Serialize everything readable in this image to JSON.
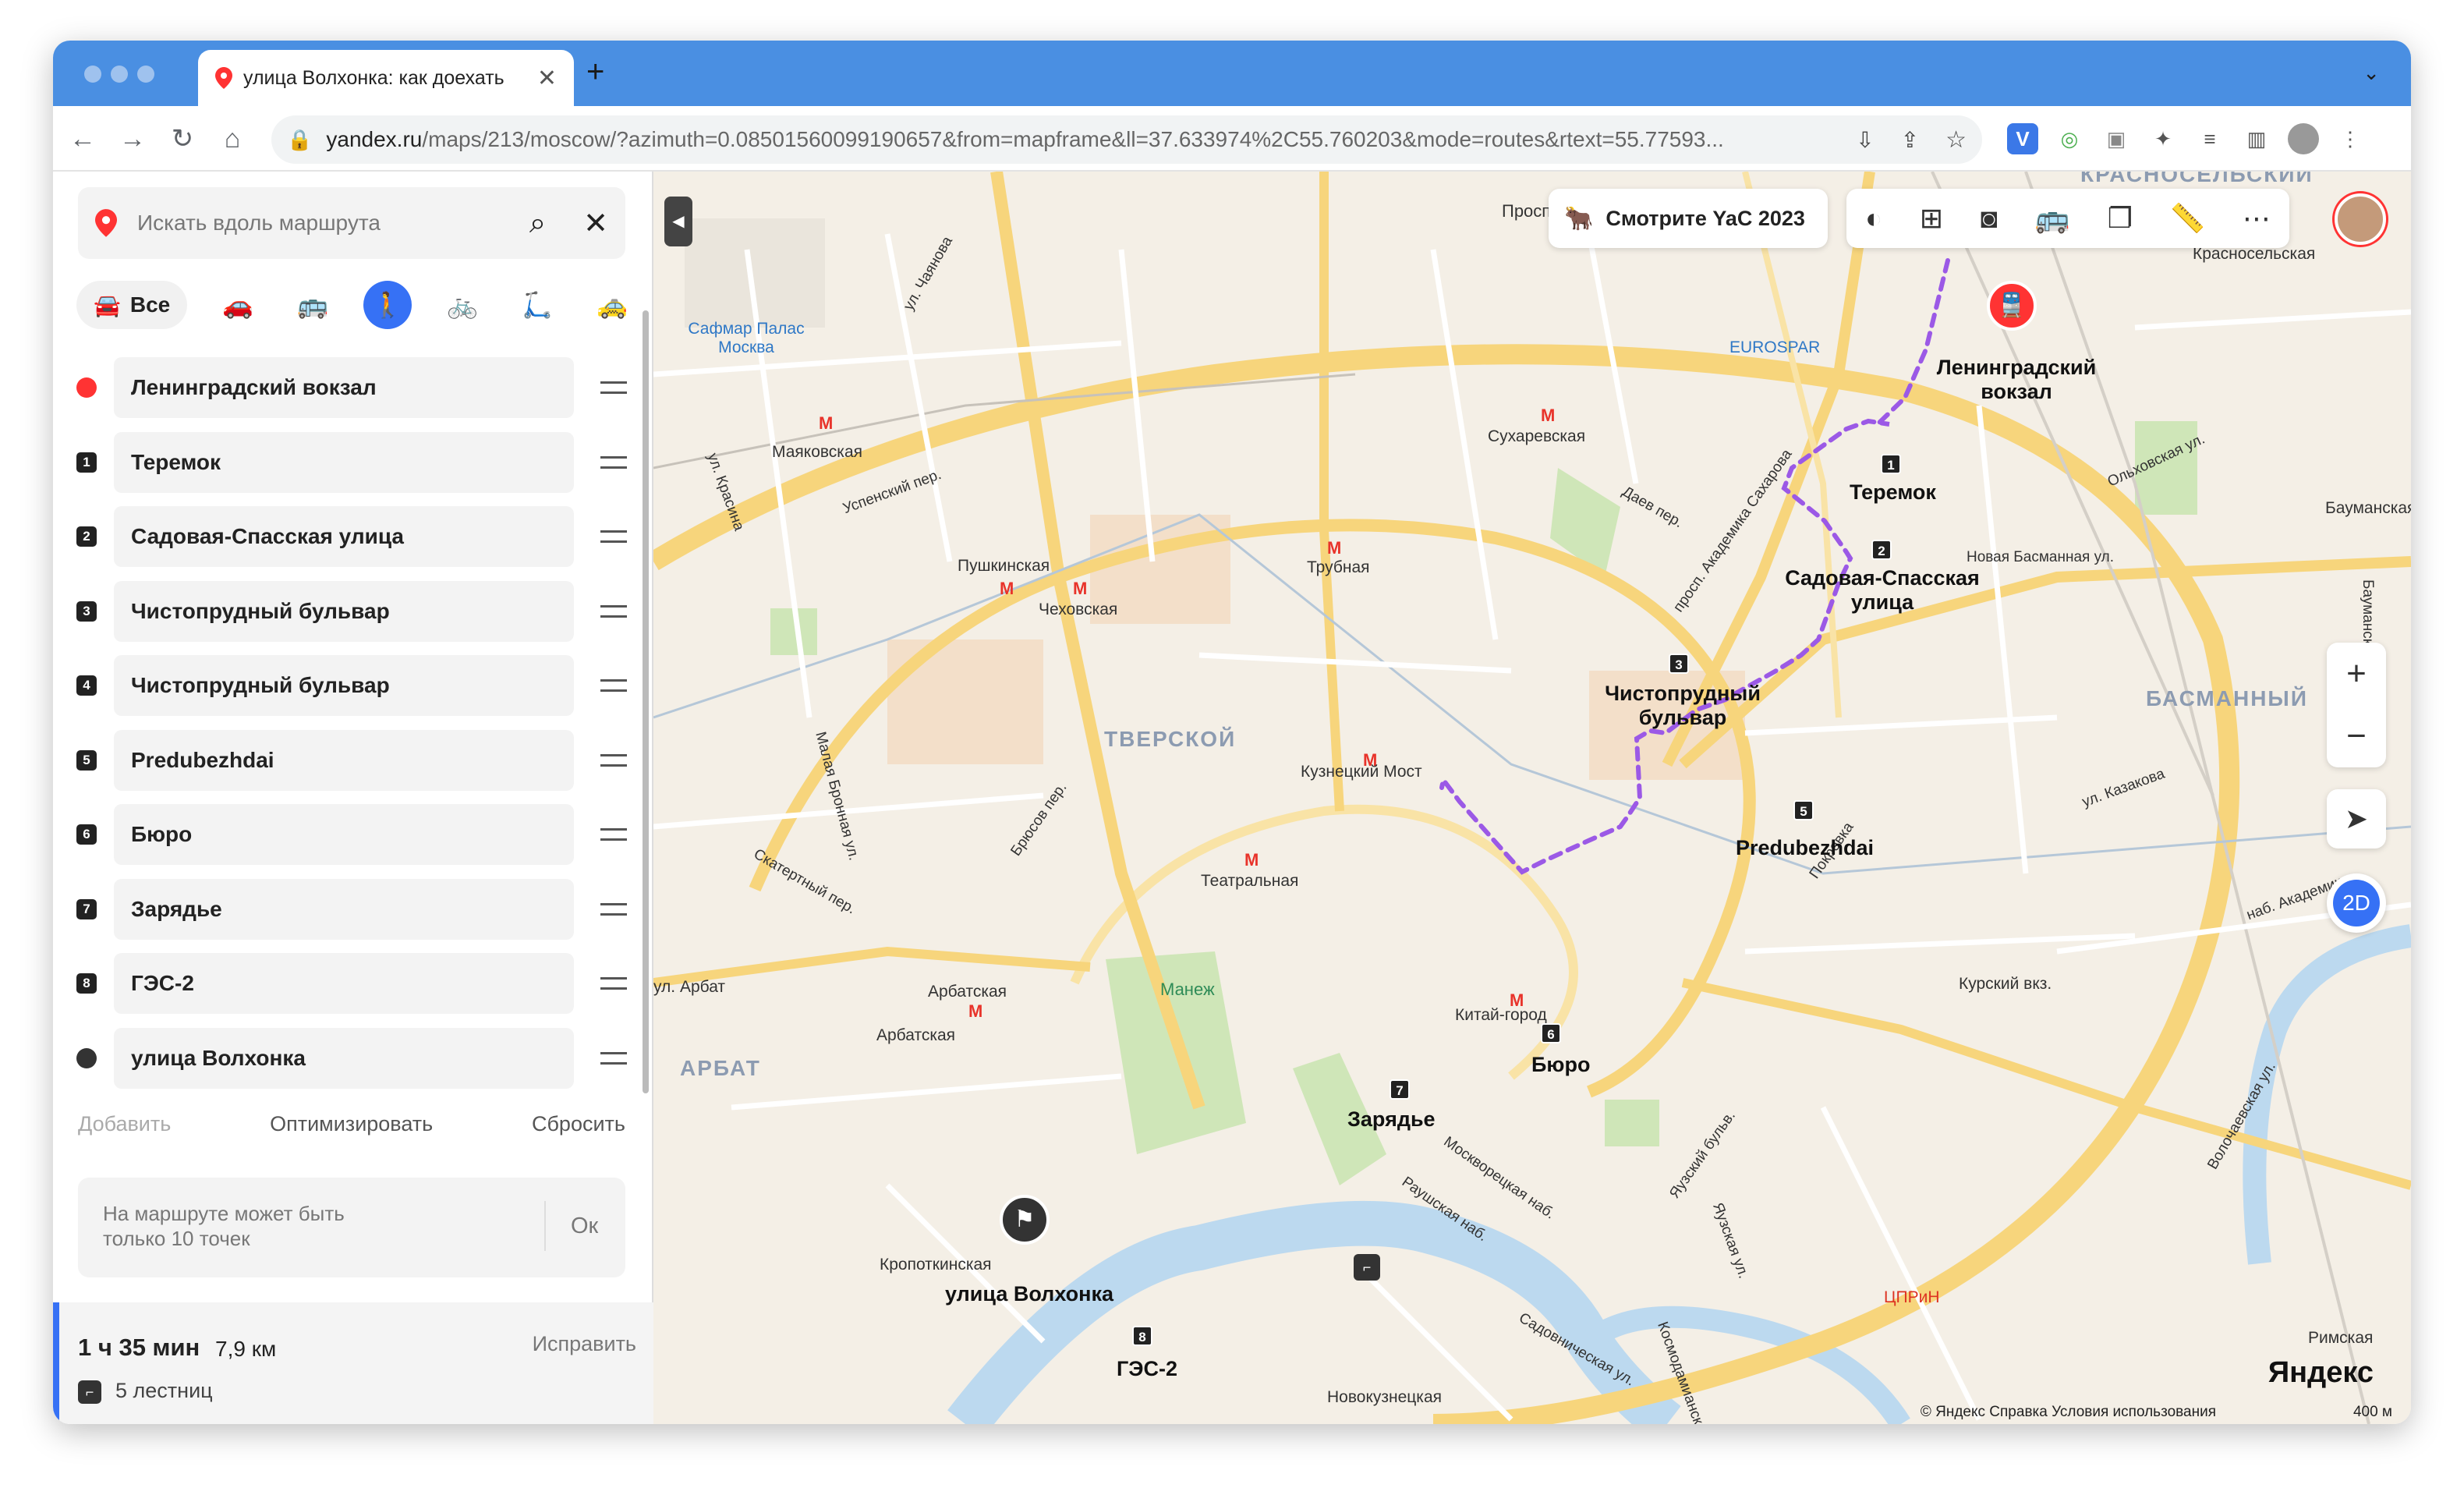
{
  "browser": {
    "tab_title": "улица Волхонка: как доехать",
    "url_host": "yandex.ru",
    "url_rest": "/maps/213/moscow/?azimuth=0.08501560099190657&from=mapframe&ll=37.633974%2C55.760203&mode=routes&rtext=55.77593..."
  },
  "search": {
    "placeholder": "Искать вдоль маршрута"
  },
  "modes": {
    "all_label": "Все",
    "selected": "pedestrian"
  },
  "route_points": [
    {
      "marker": "",
      "type": "start",
      "label": "Ленинградский вокзал"
    },
    {
      "marker": "1",
      "type": "stop",
      "label": "Теремок"
    },
    {
      "marker": "2",
      "type": "stop",
      "label": "Садовая-Спасская улица"
    },
    {
      "marker": "3",
      "type": "stop",
      "label": "Чистопрудный бульвар"
    },
    {
      "marker": "4",
      "type": "stop",
      "label": "Чистопрудный бульвар"
    },
    {
      "marker": "5",
      "type": "stop",
      "label": "Predubezhdai"
    },
    {
      "marker": "6",
      "type": "stop",
      "label": "Бюро"
    },
    {
      "marker": "7",
      "type": "stop",
      "label": "Зарядье"
    },
    {
      "marker": "8",
      "type": "stop",
      "label": "ГЭС-2"
    },
    {
      "marker": "",
      "type": "end",
      "label": "улица Волхонка"
    }
  ],
  "actions": {
    "add": "Добавить",
    "optimize": "Оптимизировать",
    "reset": "Сбросить"
  },
  "limit": {
    "message": "На маршруте может быть только 10 точек",
    "ok": "Ок"
  },
  "summary": {
    "time": "1 ч 35 мин",
    "distance": "7,9 км",
    "fix": "Исправить",
    "stairs": "5 лестниц"
  },
  "map": {
    "promo": "Смотрите YaC 2023",
    "mode_2d": "2D",
    "logo": "Яндекс",
    "copyright": "© Яндекс   Справка   Условия использования",
    "scale": "400 м",
    "districts": [
      "ТВЕРСКОЙ",
      "БАСМАННЫЙ",
      "АРБАТ",
      "КРАСНОСЕЛЬСКИЙ"
    ],
    "metro": [
      "Маяковская",
      "Пушкинская",
      "Чеховская",
      "Трубная",
      "Сухаревская",
      "Кузнецкий Мост",
      "Театральная",
      "Арбатская",
      "Арбатская",
      "Китай-город",
      "Кропоткинская",
      "Новокузнецкая",
      "Красносельская",
      "Бауманская",
      "Курский вкз.",
      "Римская"
    ],
    "pois": [
      "Сафмар Палас Москва",
      "EUROSPAR",
      "Манеж",
      "ЦПРиН",
      "Проспект"
    ],
    "streets": [
      "ул. Чаянова",
      "ул. Красина",
      "Успенский пер.",
      "Даев пер.",
      "просп. Академика Сахарова",
      "Новая Басманная ул.",
      "Ольховская ул.",
      "ул. Казакова",
      "наб. Академика",
      "Малая Бронная ул.",
      "Брюсов пер.",
      "Скатертный пер.",
      "ул. Арбат",
      "Москворецкая наб.",
      "Раушская наб.",
      "Яузский бульв.",
      "Яузская ул.",
      "Садовническая ул.",
      "Волочаевская ул.",
      "Космодамианская",
      "Покровка",
      "Бауманская ул."
    ],
    "waypoints": [
      {
        "n": "1",
        "name": "Теремок"
      },
      {
        "n": "2",
        "name": "Садовая-Спасская улица"
      },
      {
        "n": "3",
        "name": "Чистопрудный бульвар"
      },
      {
        "n": "5",
        "name": "Predubezhdai"
      },
      {
        "n": "6",
        "name": "Бюро"
      },
      {
        "n": "7",
        "name": "Зарядье"
      },
      {
        "n": "8",
        "name": "ГЭС-2"
      }
    ],
    "start_label": "Ленинградский вокзал",
    "end_label": "улица Волхонка"
  },
  "colors": {
    "accent": "#3671f5",
    "route": "#9b59e6",
    "start": "#f33",
    "tabstrip": "#4a8fe2"
  }
}
